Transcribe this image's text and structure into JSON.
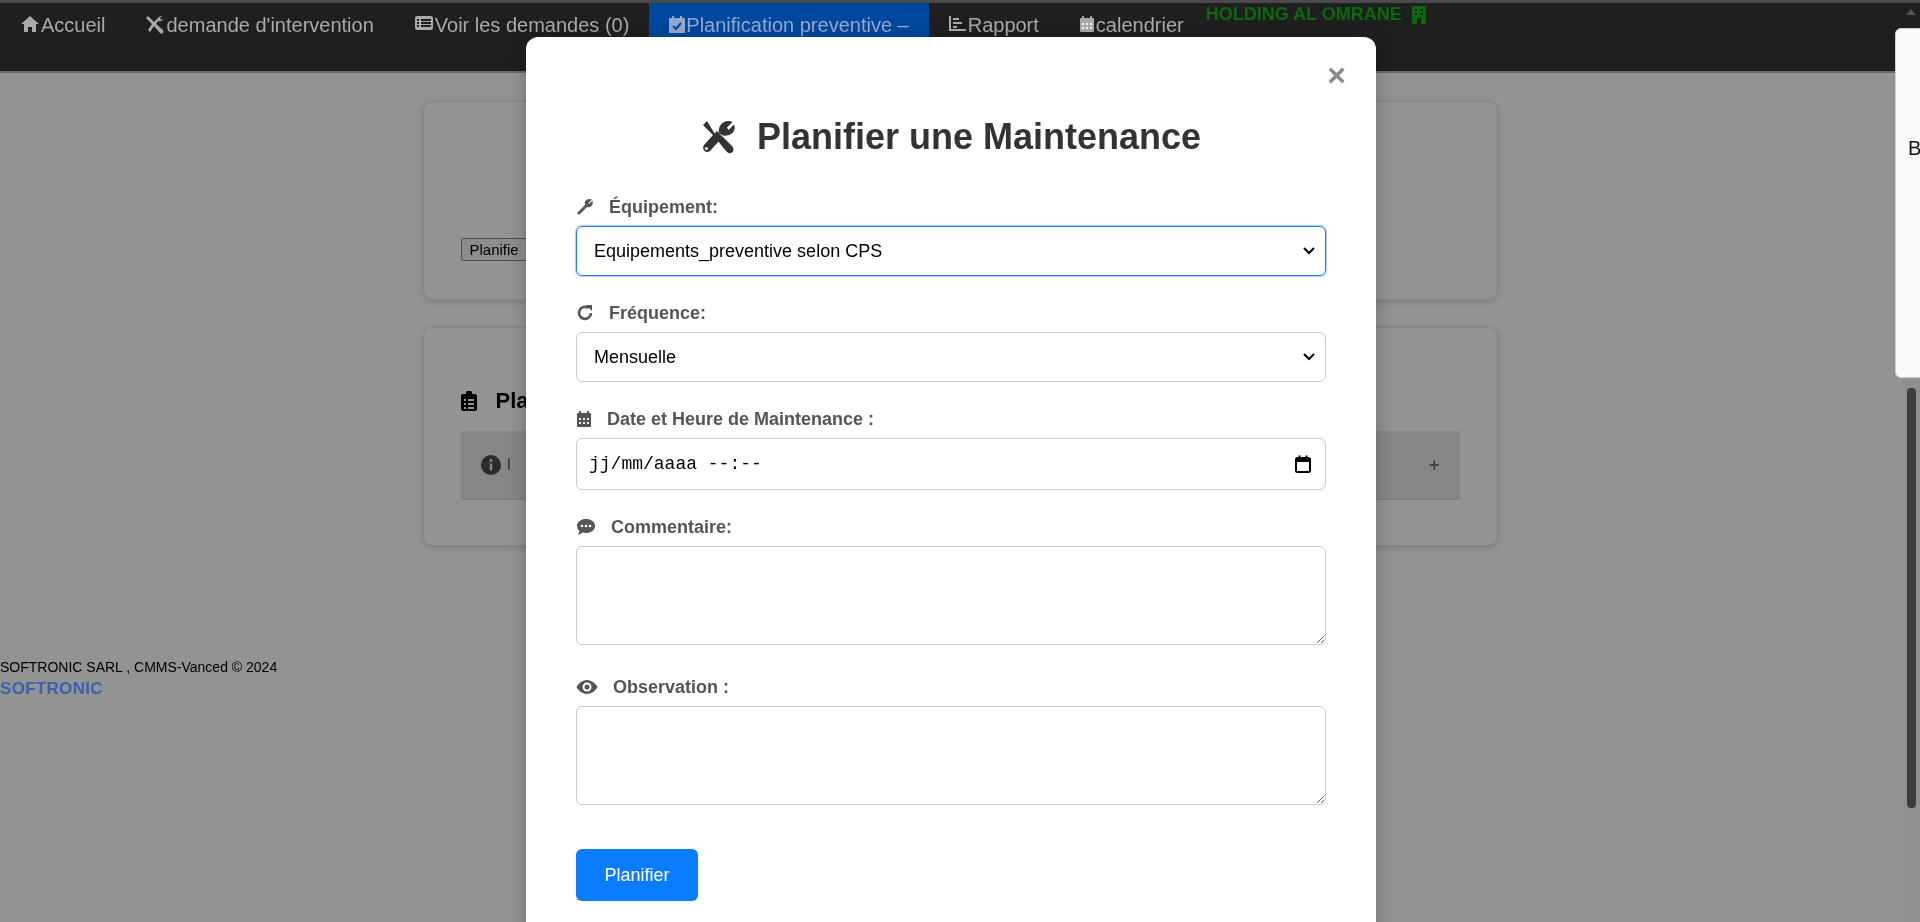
{
  "nav": {
    "items": [
      {
        "label": "Accueil",
        "selected": false
      },
      {
        "label": "demande d'intervention",
        "selected": false
      },
      {
        "label": "Voir les demandes (0)",
        "selected": false
      },
      {
        "label": "Planification preventive –",
        "selected": true
      },
      {
        "label": "Rapport",
        "selected": false
      },
      {
        "label": "calendrier",
        "selected": false
      }
    ],
    "brand": "HOLDING AL OMRANE"
  },
  "background": {
    "card_button": "Planifie",
    "section_title": "Pla",
    "row_text": "I",
    "row_toggle": "+"
  },
  "footer": {
    "copyright": "SOFTRONIC SARL , CMMS-Vanced © 2024",
    "logo": "SOFTRONIC"
  },
  "side_panel": {
    "text": "B"
  },
  "modal": {
    "title": "Planifier une Maintenance",
    "close": "×",
    "fields": [
      {
        "kind": "select",
        "label": "Équipement:",
        "value": "Equipements_preventive selon CPS",
        "focused": true
      },
      {
        "kind": "select",
        "label": "Fréquence:",
        "value": "Mensuelle",
        "focused": false
      },
      {
        "kind": "datetime",
        "label": "Date et Heure de Maintenance :",
        "placeholder": "jj/mm/aaaa --:--"
      },
      {
        "kind": "textarea",
        "label": "Commentaire:"
      },
      {
        "kind": "textarea",
        "label": "Observation :"
      }
    ],
    "submit": "Planifier"
  }
}
